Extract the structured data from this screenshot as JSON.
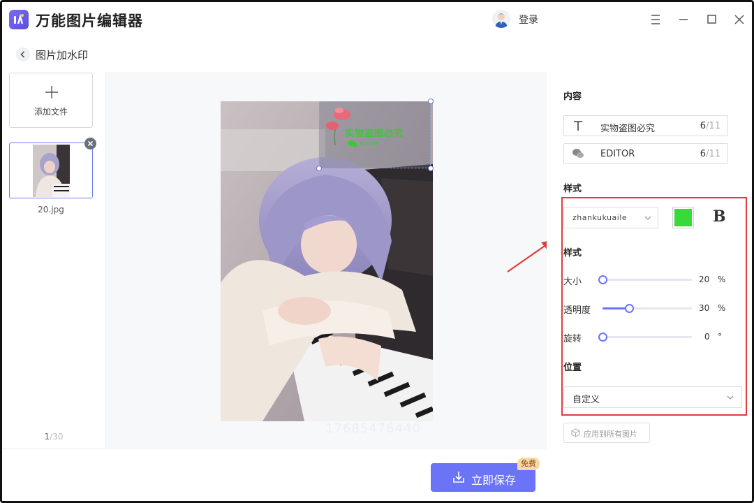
{
  "app": {
    "title": "万能图片编辑器",
    "login_label": "登录",
    "brand_color": "#6b73f7"
  },
  "breadcrumb": {
    "title": "图片加水印"
  },
  "files": {
    "add_label": "添加文件",
    "items": [
      {
        "name": "20.jpg",
        "selected": true
      }
    ],
    "page_current": "1",
    "page_total": "/30"
  },
  "canvas": {
    "watermark_line1": "实物盗图必究",
    "watermark_line2": "EDITOR",
    "ghost_text": "17685476440"
  },
  "actions": {
    "save_label": "立即保存",
    "free_badge": "免费",
    "apply_all_label": "应用到所有图片"
  },
  "panel": {
    "content_label": "内容",
    "text_items": [
      {
        "icon": "text-icon",
        "value": "实物盗图必究",
        "count": "6",
        "max": "/11"
      },
      {
        "icon": "wechat-icon",
        "value": "EDITOR",
        "count": "6",
        "max": "/11"
      }
    ],
    "style_label": "样式",
    "font": "zhankukuaile",
    "color": "#3ad93a",
    "bold_label": "B",
    "style_label_2": "样式",
    "sliders": [
      {
        "label": "大小",
        "value": 20,
        "display": "20",
        "unit": "%",
        "fraction": 0.0
      },
      {
        "label": "透明度",
        "value": 30,
        "display": "30",
        "unit": "%",
        "fraction": 0.3
      },
      {
        "label": "旋转",
        "value": 0,
        "display": "0",
        "unit": "°",
        "fraction": 0.0
      }
    ],
    "position_label": "位置",
    "position_value": "自定义"
  }
}
